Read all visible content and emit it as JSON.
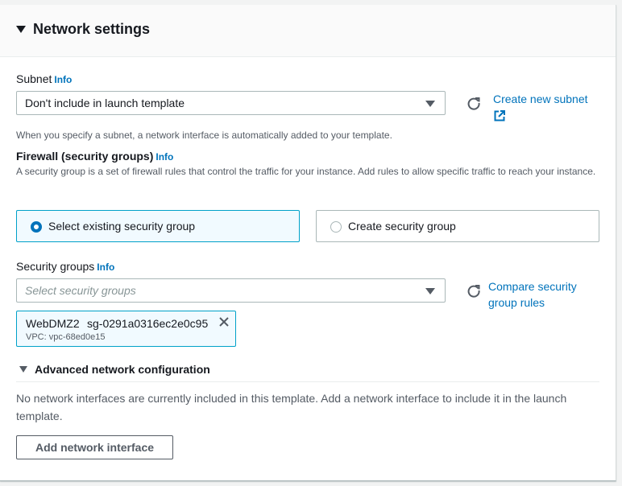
{
  "header": {
    "title": "Network settings"
  },
  "subnet": {
    "label": "Subnet",
    "info": "Info",
    "value": "Don't include in launch template",
    "create_link": "Create new subnet",
    "description": "When you specify a subnet, a network interface is automatically added to your template."
  },
  "firewall": {
    "label": "Firewall (security groups)",
    "info": "Info",
    "description": "A security group is a set of firewall rules that control the traffic for your instance. Add rules to allow specific traffic to reach your instance.",
    "options": [
      {
        "label": "Select existing security group",
        "selected": true
      },
      {
        "label": "Create security group",
        "selected": false
      }
    ]
  },
  "security_groups": {
    "label": "Security groups",
    "info": "Info",
    "placeholder": "Select security groups",
    "compare_link_line1": "Compare security",
    "compare_link_line2": "group rules",
    "selected": [
      {
        "name": "WebDMZ2",
        "id": "sg-0291a0316ec2e0c95",
        "vpc": "VPC: vpc-68ed0e15"
      }
    ]
  },
  "advanced": {
    "title": "Advanced network configuration",
    "message": "No network interfaces are currently included in this template. Add a network interface to include it in the launch template.",
    "add_button": "Add network interface"
  },
  "colors": {
    "link": "#0073bb",
    "selected_border": "#00a1c9",
    "selected_bg": "#f1faff"
  }
}
